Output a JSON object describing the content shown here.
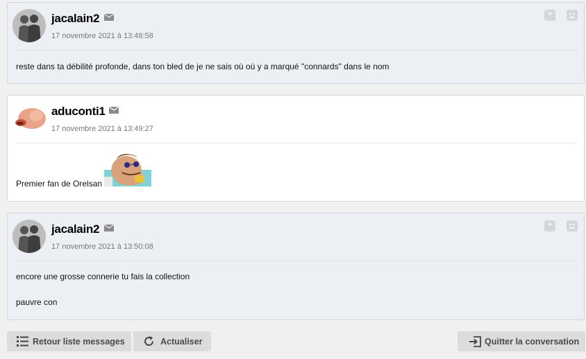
{
  "messages": [
    {
      "author": "jacalain2",
      "date": "17 novembre 2021 à 13:48:58",
      "lines": [
        "reste dans ta débilité profonde, dans ton bled de je ne sais où où y a marqué \"connards\" dans le nom"
      ]
    },
    {
      "author": "aduconti1",
      "date": "17 novembre 2021 à 13:49:27",
      "lines": [
        "Premier fan de Orelsan"
      ]
    },
    {
      "author": "jacalain2",
      "date": "17 novembre 2021 à 13:50:08",
      "lines": [
        "encore une grosse connerie tu fais la collection",
        "pauvre con"
      ]
    }
  ],
  "toolbar": {
    "back_label": "Retour liste messages",
    "refresh_label": "Actualiser",
    "leave_label": "Quitter la conversation"
  },
  "colors": {
    "alt_background": "#eceff4",
    "page_background": "#f0f0f0",
    "button_background": "#dcdcdc"
  }
}
